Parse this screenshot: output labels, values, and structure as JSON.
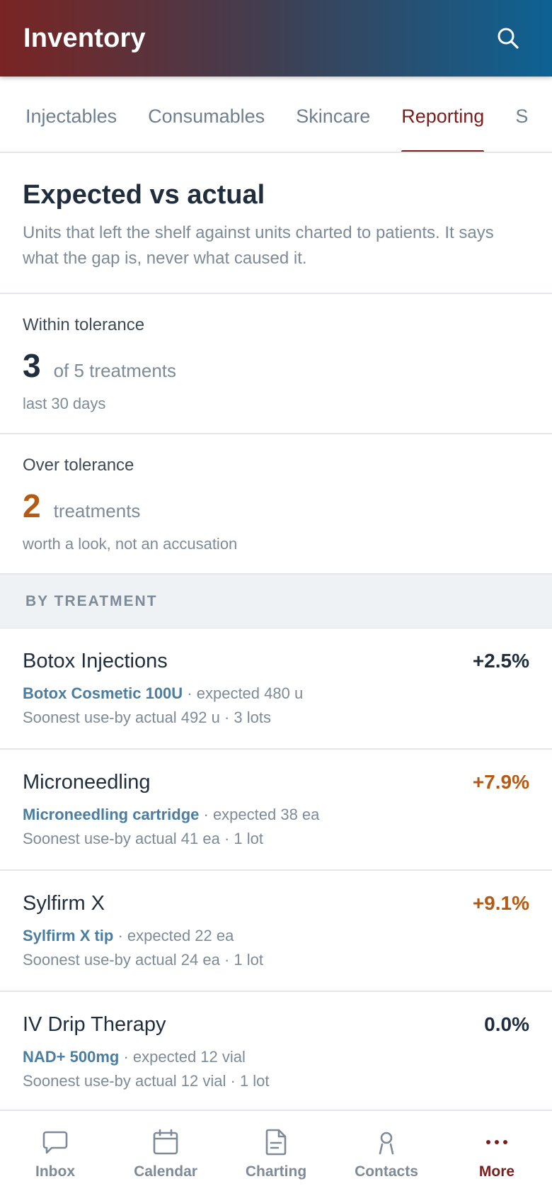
{
  "header": {
    "title": "Inventory"
  },
  "tabs": [
    {
      "label": "Injectables"
    },
    {
      "label": "Consumables"
    },
    {
      "label": "Skincare"
    },
    {
      "label": "Reporting"
    },
    {
      "label": "S"
    }
  ],
  "intro": {
    "title": "Expected vs actual",
    "description": "Units that left the shelf against units charted to patients. It says what the gap is, never what caused it."
  },
  "stats": {
    "within": {
      "label": "Within tolerance",
      "value": "3",
      "unit": "of 5 treatments",
      "sub": "last 30 days"
    },
    "over": {
      "label": "Over tolerance",
      "value": "2",
      "unit": "treatments",
      "sub": "worth a look, not an accusation"
    }
  },
  "section": {
    "title": "BY TREATMENT"
  },
  "treatments": [
    {
      "name": "Botox Injections",
      "pct": "+2.5%",
      "product": "Botox Cosmetic 100U",
      "expected": " · expected 480 u",
      "actual": "Soonest use-by actual 492 u · 3 lots"
    },
    {
      "name": "Microneedling",
      "pct": "+7.9%",
      "product": "Microneedling cartridge",
      "expected": " · expected 38 ea",
      "actual": "Soonest use-by actual 41 ea · 1 lot"
    },
    {
      "name": "Sylfirm X",
      "pct": "+9.1%",
      "product": "Sylfirm X tip",
      "expected": " · expected 22 ea",
      "actual": "Soonest use-by actual 24 ea · 1 lot"
    },
    {
      "name": "IV Drip Therapy",
      "pct": "0.0%",
      "product": "NAD+ 500mg",
      "expected": " · expected 12 vial",
      "actual": "Soonest use-by actual 12 vial · 1 lot"
    }
  ],
  "nav": [
    {
      "label": "Inbox",
      "icon": "chat-bubble-icon"
    },
    {
      "label": "Calendar",
      "icon": "calendar-icon"
    },
    {
      "label": "Charting",
      "icon": "document-icon"
    },
    {
      "label": "Contacts",
      "icon": "person-icon"
    },
    {
      "label": "More",
      "icon": "more-dots-icon"
    }
  ],
  "colors": {
    "accent": "#7a1d1d",
    "warning": "#b55a12",
    "link": "#4a7da0"
  }
}
